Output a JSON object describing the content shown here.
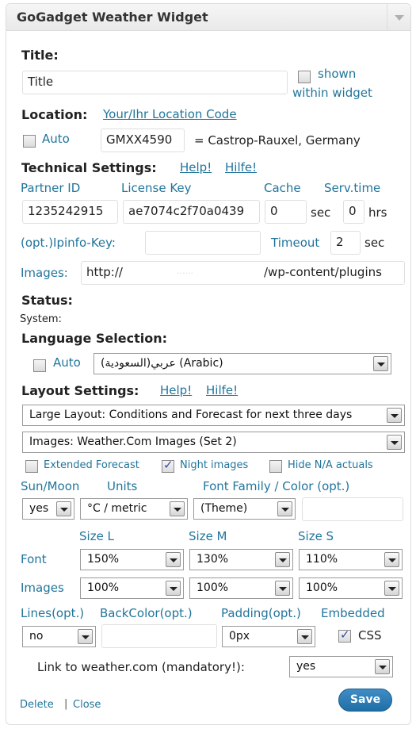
{
  "widget": {
    "title": "GoGadget Weather Widget",
    "toggle_icon": "chevron-down-icon"
  },
  "title_section": {
    "label": "Title:",
    "value": "Title",
    "shown_label_1": "shown",
    "shown_label_2": "within widget",
    "shown_checked": false
  },
  "location": {
    "label": "Location:",
    "code_link": "Your/Ihr Location Code",
    "auto_label": "Auto",
    "auto_checked": false,
    "code_value": "GMXX4590",
    "resolved": "= Castrop-Rauxel, Germany"
  },
  "technical": {
    "label": "Technical Settings:",
    "help_en": "Help!",
    "help_de": "Hilfe!",
    "partner_id_label": "Partner ID",
    "license_key_label": "License Key",
    "cache_label": "Cache",
    "serv_time_label": "Serv.time",
    "partner_id": "1235242915",
    "license_key": "ae7074c2f70a0439",
    "cache": "0",
    "cache_unit": "sec",
    "serv_time": "0",
    "serv_time_unit": "hrs",
    "ipinfo_label": "(opt.)Ipinfo-Key:",
    "ipinfo_value": "",
    "timeout_label": "Timeout",
    "timeout_value": "2",
    "timeout_unit": "sec",
    "images_label": "Images:",
    "images_path_start": "http://",
    "images_path_mid": "......",
    "images_path_end": "/wp-content/plugins"
  },
  "status": {
    "label": "Status:",
    "system": "System:"
  },
  "language": {
    "label": "Language Selection:",
    "auto_label": "Auto",
    "auto_checked": false,
    "selected": "عربي(السعودية) (Arabic)"
  },
  "layout": {
    "label": "Layout Settings:",
    "help_en": "Help!",
    "help_de": "Hilfe!",
    "layout_selected": "Large Layout: Conditions and Forecast for next three days",
    "images_selected": "Images: Weather.Com Images (Set 2)",
    "extended_forecast": "Extended Forecast",
    "extended_checked": false,
    "night_images": "Night images",
    "night_checked": true,
    "hide_na": "Hide N/A actuals",
    "hide_na_checked": false,
    "sun_moon_label": "Sun/Moon",
    "units_label": "Units",
    "font_family_label": "Font Family / Color (opt.)",
    "sun_moon_value": "yes",
    "units_value": "°C / metric",
    "font_family_value": "(Theme)",
    "color_value": "",
    "size_l": "Size L",
    "size_m": "Size M",
    "size_s": "Size S",
    "font_label": "Font",
    "images_label": "Images",
    "font_l": "150%",
    "font_m": "130%",
    "font_s": "110%",
    "img_l": "100%",
    "img_m": "100%",
    "img_s": "100%",
    "lines_label": "Lines(opt.)",
    "backcolor_label": "BackColor(opt.)",
    "padding_label": "Padding(opt.)",
    "embedded_label": "Embedded",
    "lines_value": "no",
    "backcolor_value": "",
    "padding_value": "0px",
    "css_label": "CSS",
    "css_checked": true,
    "link_label": "Link to weather.com (mandatory!):",
    "link_value": "yes"
  },
  "footer": {
    "delete": "Delete",
    "separator": "|",
    "close": "Close",
    "save": "Save"
  },
  "colors": {
    "link": "#21759b",
    "save_button": "#2a7bb5"
  }
}
